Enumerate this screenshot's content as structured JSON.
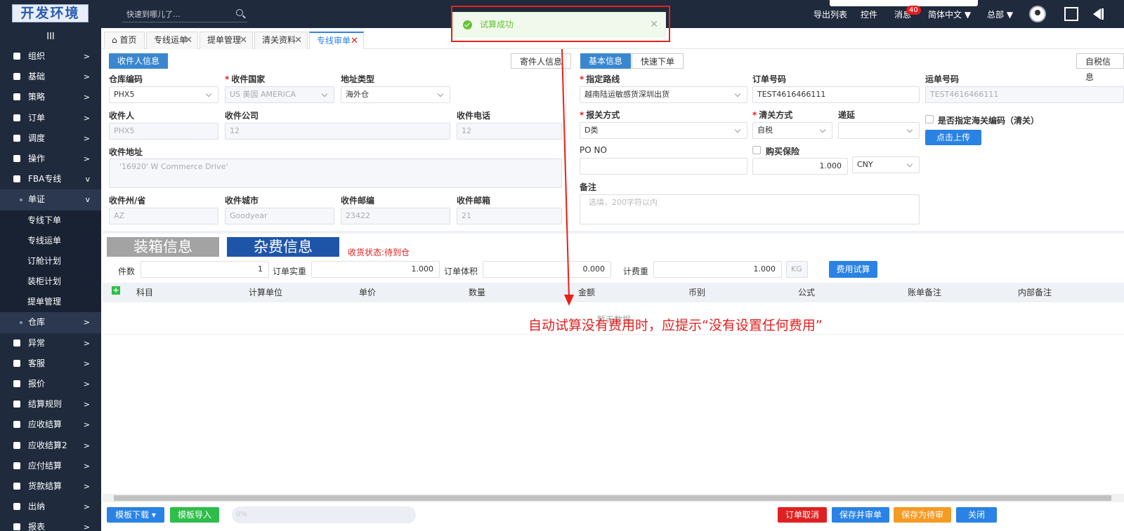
{
  "logo": "开发环境",
  "top": {
    "search_placeholder": "快速到哪儿了...",
    "export_list": "导出列表",
    "widgets": "控件",
    "messages": "消息",
    "badge": "40",
    "language": "简体中文 ▼",
    "org": "总部 ▼"
  },
  "sidebar": {
    "toggle": "III",
    "items": [
      "组织",
      "基础",
      "策略",
      "订单",
      "调度",
      "操作",
      "FBA专线",
      "单证",
      "专线下单",
      "专线运单",
      "订舱计划",
      "装柜计划",
      "提单管理",
      "仓库",
      "异常",
      "客服",
      "报价",
      "结算规则",
      "应收结算",
      "应收结算2",
      "应付结算",
      "货款结算",
      "出纳",
      "报表"
    ]
  },
  "tabs": {
    "home": "首页",
    "t1": "专线运单",
    "t2": "提单管理",
    "t3": "清关资料",
    "t4": "专线审单"
  },
  "toast": "试算成功",
  "left": {
    "tab_receiver": "收件人信息",
    "tab_sender": "寄件人信息",
    "warehouse_label": "仓库编码",
    "warehouse": "PHX5",
    "country_label": "收件国家",
    "country": "US 美国 AMERICA",
    "addrtype_label": "地址类型",
    "addrtype": "海外仓",
    "receiver_label": "收件人",
    "receiver": "PHX5",
    "company_label": "收件公司",
    "company": "12",
    "phone_label": "收件电话",
    "phone": "12",
    "address_label": "收件地址",
    "address": "'16920' W Commerce Drive'",
    "state_label": "收件州/省",
    "state": "AZ",
    "city_label": "收件城市",
    "city": "Goodyear",
    "zip_label": "收件邮编",
    "zip": "23422",
    "email_label": "收件邮箱",
    "email": "21"
  },
  "right": {
    "tab_basic": "基本信息",
    "tab_quick": "快速下单",
    "tab_tax": "自税信息",
    "route_label": "指定路线",
    "route": "越南陆运敏感货深圳出货",
    "orderno_label": "订单号码",
    "orderno": "TEST4616466111",
    "waybill_label": "运单号码",
    "waybill": "TEST4616466111",
    "decl_label": "报关方式",
    "decl": "D类",
    "clear_label": "清关方式",
    "clear": "自税",
    "defer_label": "递延",
    "customs_chk": "是否指定海关编码（清关）",
    "upload": "点击上传",
    "pono_label": "PO NO",
    "ins_label": "购买保险",
    "ins_value": "1.000",
    "currency": "CNY",
    "remark_label": "备注",
    "remark_placeholder": "选填，200字符以内"
  },
  "section": {
    "packing": "装箱信息",
    "fees": "杂费信息",
    "status": "收货状态:待到仓",
    "pieces_label": "件数",
    "pieces": "1",
    "weight_label": "订单实重",
    "weight": "1.000",
    "volume_label": "订单体积",
    "volume": "0.000",
    "charge_label": "计费重",
    "charge": "1.000",
    "unit": "KG",
    "calc_btn": "费用试算"
  },
  "table": {
    "add": "+",
    "cols": [
      "科目",
      "计算单位",
      "单价",
      "数量",
      "金额",
      "币别",
      "公式",
      "账单备注",
      "内部备注"
    ],
    "empty": "暂无数据"
  },
  "annotation": "自动试算没有费用时，应提示“没有设置任何费用”",
  "footer": {
    "tpl_download": "模板下载 ▾",
    "tpl_import": "模板导入",
    "progress": "0%",
    "cancel": "订单取消",
    "save_audit": "保存并审单",
    "save_pending": "保存为待审",
    "close": "关闭"
  }
}
